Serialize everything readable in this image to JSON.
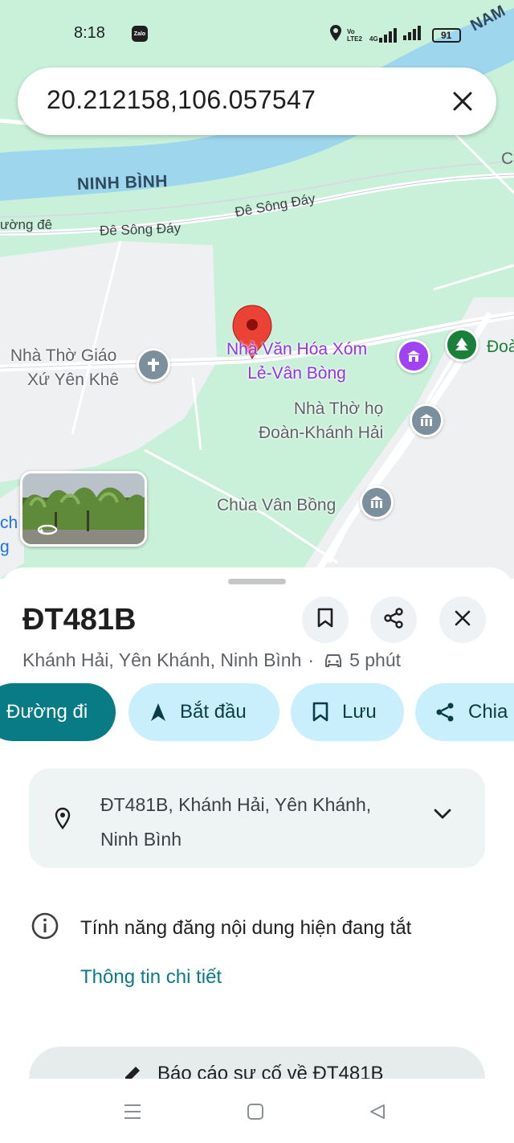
{
  "status_bar": {
    "time": "8:18",
    "zalo_label": "Zalo",
    "volte_label": "Vo LTE2",
    "network_label": "4G",
    "battery": "91"
  },
  "search": {
    "query": "20.212158,106.057547",
    "clear_icon": "close-icon"
  },
  "map": {
    "river_label": "NINH BÌNH",
    "top_right_label": "NAM",
    "road_label_1": "Đê Sông Đáy",
    "road_label_2": "Đê Sông Đáy",
    "road_label_left": "ường đê",
    "edge_right_top": "C",
    "poi_church_1": [
      "Nhà Thờ Giáo",
      "Xứ Yên Khê"
    ],
    "poi_cultural_house": [
      "Nhà Văn Hóa Xóm",
      "Lẻ-Vân Bòng"
    ],
    "poi_park_partial": "Đoà",
    "poi_church_2": [
      "Nhà Thờ họ",
      "Đoàn-Khánh Hải"
    ],
    "poi_pagoda": "Chùa Vân Bồng",
    "left_edge_blue": [
      "ch",
      "g"
    ],
    "colors": {
      "land": "#c9f0d8",
      "water": "#9ed6ee",
      "urban": "#eef0f1",
      "pin": "#ea4335",
      "purple": "#9334e6",
      "green": "#188038"
    }
  },
  "sheet": {
    "title": "ĐT481B",
    "subtitle_location": "Khánh Hải, Yên Khánh, Ninh Bình",
    "separator": "·",
    "drive_time": "5 phút",
    "actions": {
      "directions": "Đường đi",
      "start": "Bắt đầu",
      "save": "Lưu",
      "share": "Chia"
    },
    "address": "ĐT481B, Khánh Hải, Yên Khánh, Ninh Bình",
    "info_text": "Tính năng đăng nội dung hiện đang tắt",
    "details_link": "Thông tin chi tiết",
    "report_button": "Báo cáo sự cố về ĐT481B",
    "accent_color": "#097b85"
  },
  "nav_bar": {
    "items": [
      "menu-icon",
      "home-square-icon",
      "back-triangle-icon"
    ]
  }
}
